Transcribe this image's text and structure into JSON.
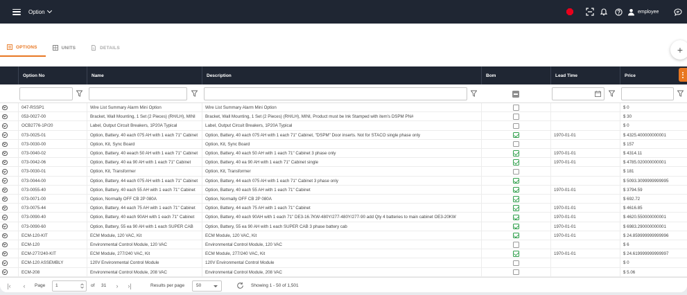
{
  "topbar": {
    "title": "Option",
    "user_name": "employee",
    "icons": [
      "menu-icon",
      "record-icon",
      "scan-icon",
      "bell-icon",
      "help-icon",
      "user-icon",
      "chat-icon"
    ]
  },
  "tabs": [
    {
      "label": "OPTIONS",
      "icon": "list-icon",
      "active": true
    },
    {
      "label": "UNITS",
      "icon": "grid-icon",
      "active": false
    },
    {
      "label": "DETAILS",
      "icon": "document-icon",
      "active": false,
      "disabled": true
    }
  ],
  "accent_color": "#e87722",
  "grid": {
    "columns": [
      {
        "key": "option_no",
        "label": "Option No"
      },
      {
        "key": "name",
        "label": "Name"
      },
      {
        "key": "description",
        "label": "Description"
      },
      {
        "key": "bom",
        "label": "Bom"
      },
      {
        "key": "lead_time",
        "label": "Lead Time"
      },
      {
        "key": "price",
        "label": "Price"
      }
    ],
    "rows": [
      {
        "option_no": "047-RSSP1",
        "name": "Wire List Summary Alarm Mini Option",
        "description": "Wire List Summary Alarm Mini Option",
        "bom": false,
        "lead_time": "",
        "price": "$ 0"
      },
      {
        "option_no": "053-0027-00",
        "name": "Bracket, Wall Mounting, 1 Set (2 Pieces) (RH/LH), MINI",
        "description": "Bracket, Wall Mounting, 1 Set (2 Pieces) (RH/LH), MINI, Product must be Ink Stamped with item's DSPM PN#",
        "bom": false,
        "lead_time": "",
        "price": "$ 30"
      },
      {
        "option_no": "OCB2776-1P/20",
        "name": "Label, Output Circuit Breakers, 1P20A Typical",
        "description": "Label, Output Circuit Breakers, 1P20A Typical",
        "bom": false,
        "lead_time": "",
        "price": "$ 0"
      },
      {
        "option_no": "073-0025-01",
        "name": "Option, Battery, 40 each 075 AH with 1 each 71\" Cabinet",
        "description": "Option, Battery, 40 each 075 AH with 1 each 71\" Cabinet, \"DSPM\" Door inserts. Not for STACO single phase only",
        "bom": true,
        "lead_time": "1970-01-01",
        "price": "$ 4325.400000000001"
      },
      {
        "option_no": "073-0030-00",
        "name": "Option, Kit, Sync Board",
        "description": "Option, Kit, Sync Board",
        "bom": false,
        "lead_time": "",
        "price": "$ 157"
      },
      {
        "option_no": "073-0040-02",
        "name": "Option, Battery, 40 eeach 50 AH with 1 each 71\" Cabinet",
        "description": "Option, Battery, 40 each 50 AH with 1 each 71\" Cabinet 3 phase only",
        "bom": true,
        "lead_time": "1970-01-01",
        "price": "$ 4314.11"
      },
      {
        "option_no": "073-0042-06",
        "name": "Option, Battery, 40 ea 90 AH with 1 each 71\" Cabinet",
        "description": "Option, Battery, 40 ea 90 AH with 1 each 71\" Cabinet single",
        "bom": true,
        "lead_time": "1970-01-01",
        "price": "$ 4785.020000000001"
      },
      {
        "option_no": "073-0030-01",
        "name": "Option, Kit, Transformer",
        "description": "Option, Kit, Transformer",
        "bom": false,
        "lead_time": "",
        "price": "$ 181"
      },
      {
        "option_no": "073-0044-00",
        "name": "Option, Battery, 44 each 075 AH with 1 each 71\" Cabinet",
        "description": "Option, Battery, 44 each 075 AH with 1 each 71\" Cabinet 3 phase only",
        "bom": true,
        "lead_time": "",
        "price": "$ 5093.3099999999995"
      },
      {
        "option_no": "073-0055-40",
        "name": "Option, Battery, 40 each 55 AH with 1 each 71\" Cabinet",
        "description": "Option, Battery, 40 each 55 AH with 1 each 71\" Cabinet",
        "bom": true,
        "lead_time": "1970-01-01",
        "price": "$ 3794.59"
      },
      {
        "option_no": "073-0071-00",
        "name": "Option, Normally OFF CB 2P 080A",
        "description": "Option, Normally OFF CB 2P 080A",
        "bom": true,
        "lead_time": "",
        "price": "$ 692.72"
      },
      {
        "option_no": "073-0075-44",
        "name": "Option, Battery, 44 each 75 AH with 1 each 71\" Cabinet",
        "description": "Option, Battery, 44 each 75 AH with 1 each 71\" Cabinet",
        "bom": true,
        "lead_time": "1970-01-01",
        "price": "$ 4616.85"
      },
      {
        "option_no": "073-0090-40",
        "name": "Option, Battery, 40 each 90AH with 1 each 71\" Cabinet",
        "description": "Option, Battery, 40 each 90AH with 1 each 71\" DE3-16.7KW-480Y/277-480Y/277-90 add Qty 4 batteries to main cabinet OE3-20KW",
        "bom": true,
        "lead_time": "1970-01-01",
        "price": "$ 4620.550000000001"
      },
      {
        "option_no": "073-0090-60",
        "name": "Option, Battery, 55 ea 90 AH with 1 each SUPER CAB",
        "description": "Option, Battery, 55 ea 90 AH with 1 each SUPER CAB 3 phase battery cab",
        "bom": true,
        "lead_time": "1970-01-01",
        "price": "$ 6983.290000000001"
      },
      {
        "option_no": "ECM-120-KIT",
        "name": "ECM Module, 120 VAC, Kit",
        "description": "ECM Module, 120 VAC, Kit",
        "bom": true,
        "lead_time": "1970-01-01",
        "price": "$ 24.859999999999996"
      },
      {
        "option_no": "ECM-120",
        "name": "Environmental Control Module, 120 VAC",
        "description": "Environmental Control Module, 120 VAC",
        "bom": false,
        "lead_time": "",
        "price": "$ 6"
      },
      {
        "option_no": "ECM-277/240-KIT",
        "name": "ECM Module, 277/240 VAC, Kit",
        "description": "ECM Module, 277/240 VAC, Kit",
        "bom": true,
        "lead_time": "1970-01-01",
        "price": "$ 24.619999999999997"
      },
      {
        "option_no": "ECM-120 ASSEMBLY",
        "name": "120V Environmental Control Module",
        "description": "120V Environmental Control Module",
        "bom": false,
        "lead_time": "",
        "price": "$ 0"
      },
      {
        "option_no": "ECM-208",
        "name": "Environmental Control Module, 208 VAC",
        "description": "Environmental Control Module, 208 VAC",
        "bom": false,
        "lead_time": "",
        "price": "$ 5.06"
      }
    ]
  },
  "pager": {
    "page_label": "Page",
    "page_value": "1",
    "of_label": "of",
    "total_pages": "31",
    "results_label": "Results per page",
    "per_page": "50",
    "showing": "Showing 1 - 50 of 1,501"
  }
}
